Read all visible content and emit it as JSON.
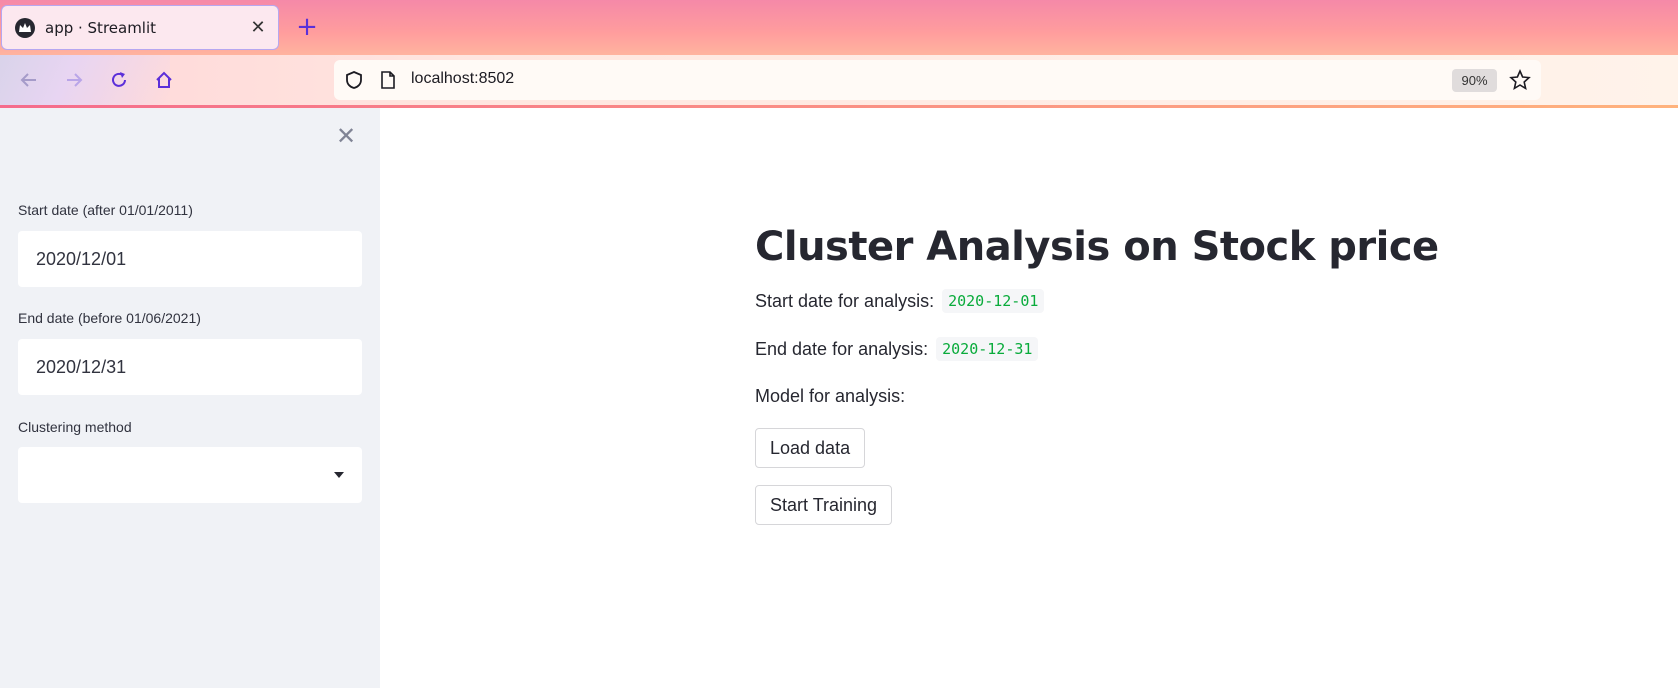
{
  "browser": {
    "tab_title": "app · Streamlit",
    "tab_close_glyph": "✕",
    "new_tab_glyph": "+",
    "url": "localhost:8502",
    "zoom": "90%",
    "icons": [
      "back-icon",
      "forward-icon",
      "reload-icon",
      "home-icon",
      "shield-icon",
      "page-icon",
      "star-icon"
    ]
  },
  "sidebar": {
    "close_glyph": "✕",
    "start_date": {
      "label": "Start date (after 01/01/2011)",
      "value": "2020/12/01"
    },
    "end_date": {
      "label": "End date (before 01/06/2021)",
      "value": "2020/12/31"
    },
    "clustering": {
      "label": "Clustering method",
      "value": ""
    }
  },
  "main": {
    "title": "Cluster Analysis on Stock price",
    "start_label": "Start date for analysis:",
    "start_value": "2020-12-01",
    "end_label": "End date for analysis:",
    "end_value": "2020-12-31",
    "model_label": "Model for analysis:",
    "load_button": "Load data",
    "train_button": "Start Training"
  },
  "colors": {
    "accent": "#5b2fd9",
    "code_text": "#09ab3b",
    "sidebar_bg": "#f0f2f6",
    "text": "#262730"
  }
}
